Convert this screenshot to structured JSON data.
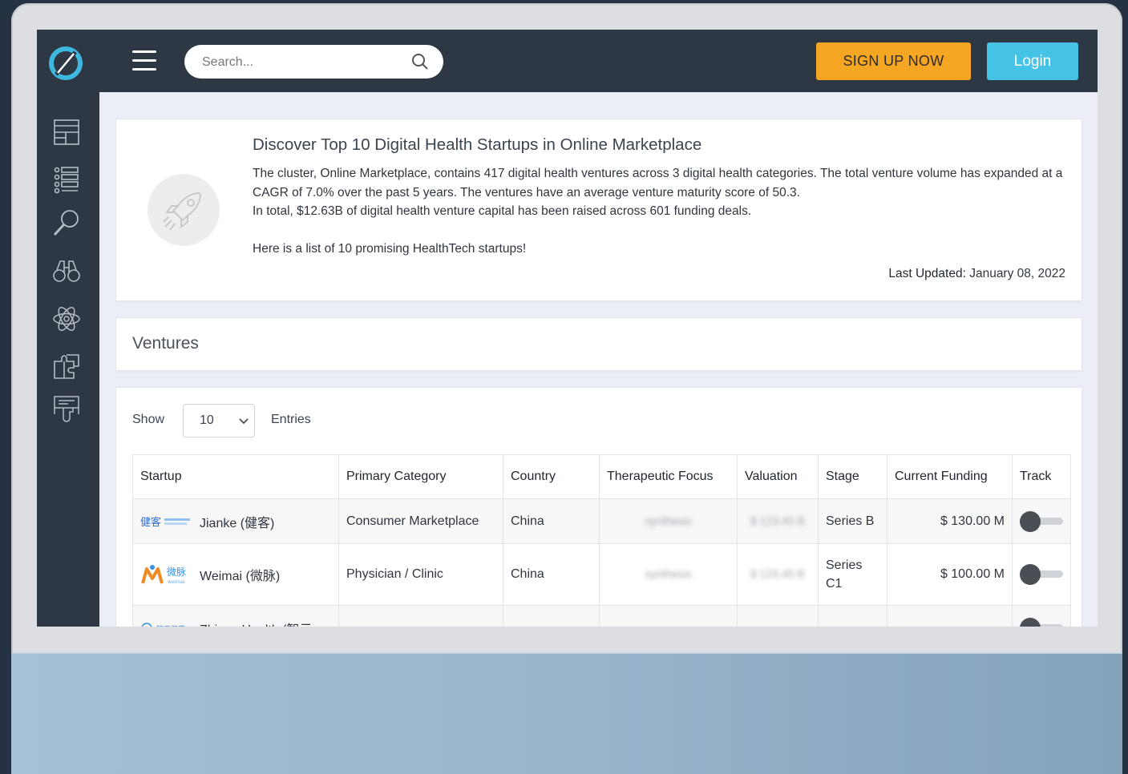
{
  "header": {
    "search_placeholder": "Search...",
    "signup_label": "SIGN UP NOW",
    "login_label": "Login"
  },
  "sidebar": {
    "items": [
      {
        "icon": "dashboard-icon"
      },
      {
        "icon": "list-icon"
      },
      {
        "icon": "search-icon"
      },
      {
        "icon": "binoculars-icon"
      },
      {
        "icon": "atom-icon"
      },
      {
        "icon": "puzzle-icon"
      },
      {
        "icon": "hand-presentation-icon"
      }
    ]
  },
  "intro": {
    "title": "Discover Top 10 Digital Health Startups in Online Marketplace",
    "line1": "The cluster, Online Marketplace, contains 417 digital health ventures across 3 digital health categories. The total venture volume has expanded at a CAGR of 7.0% over the past 5 years. The ventures have an average venture maturity score of 50.3.",
    "line2": "In total, $12.63B of digital health venture capital has been raised across 601 funding deals.",
    "line3": "Here is a list of 10 promising HealthTech startups!",
    "updated_label": "Last Updated:",
    "updated_value": "January 08, 2022"
  },
  "ventures": {
    "title": "Ventures",
    "show_label": "Show",
    "entries_value": "10",
    "entries_label": "Entries",
    "columns": [
      "Startup",
      "Primary Category",
      "Country",
      "Therapeutic Focus",
      "Valuation",
      "Stage",
      "Current Funding",
      "Track"
    ],
    "rows": [
      {
        "startup": "Jianke (健客)",
        "category": "Consumer Marketplace",
        "country": "China",
        "therapeutic": "synthesis",
        "valuation": "$ 123.45 B",
        "stage": "Series B",
        "funding": "$ 130.00 M",
        "track": false
      },
      {
        "startup": "Weimai (微脉)",
        "category": "Physician / Clinic",
        "country": "China",
        "therapeutic": "synthesis",
        "valuation": "$ 123.45 B",
        "stage": "Series C1",
        "funding": "$ 100.00 M",
        "track": false
      },
      {
        "startup": "Zhiyun Health (智云",
        "category": "",
        "country": "",
        "therapeutic": "",
        "valuation": "",
        "stage": "",
        "funding": "",
        "track": false
      }
    ]
  },
  "colors": {
    "sidebar_bg": "#2e3744",
    "signup_bg": "#f5a623",
    "login_bg": "#45c3e6",
    "page_bg": "#eceef7"
  }
}
